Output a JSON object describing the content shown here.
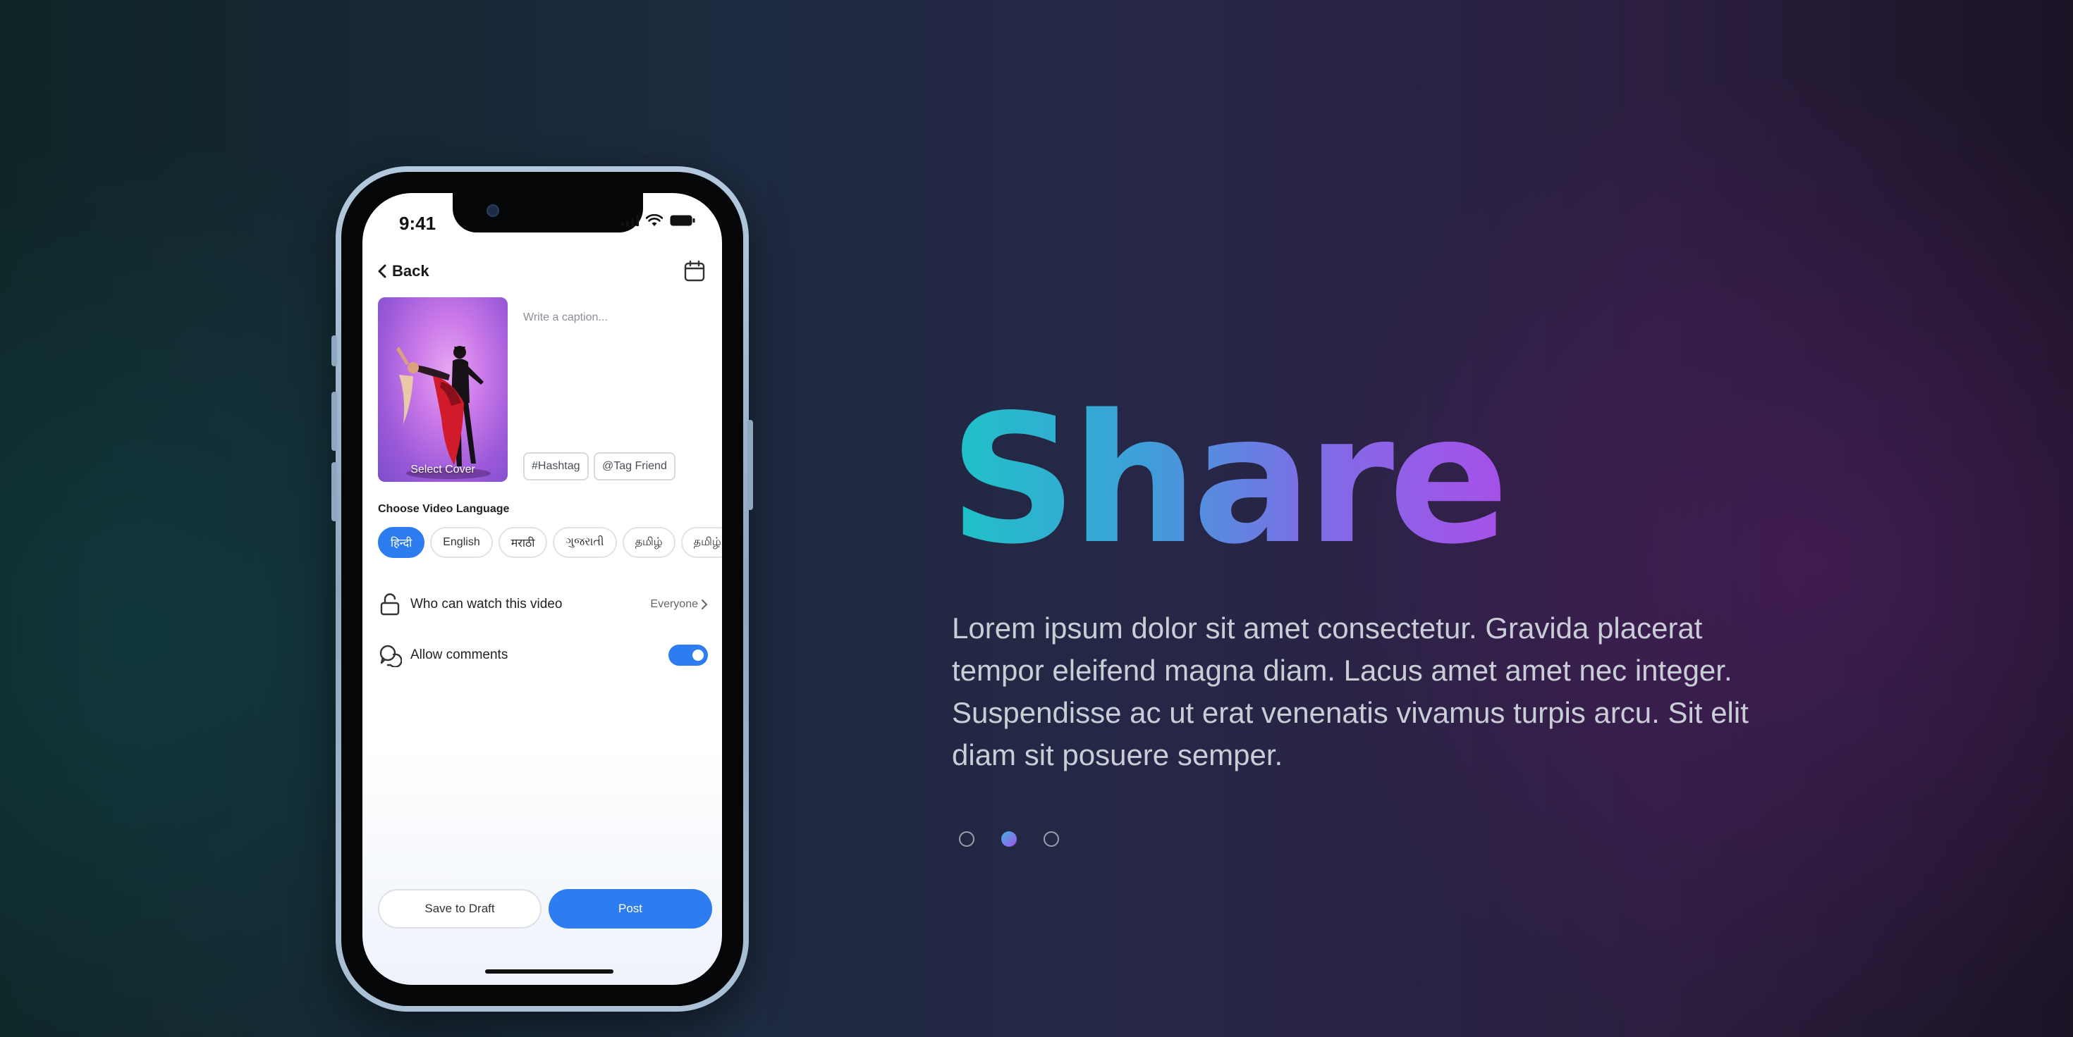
{
  "phone": {
    "status_time": "9:41",
    "back_label": "Back",
    "cover_label": "Select Cover",
    "caption_placeholder": "Write a caption...",
    "hashtag_label": "#Hashtag",
    "tag_friend_label": "@Tag Friend",
    "language_title": "Choose Video Language",
    "languages": [
      {
        "label": "हिन्दी",
        "active": true
      },
      {
        "label": "English",
        "active": false
      },
      {
        "label": "मराठी",
        "active": false
      },
      {
        "label": "ગુજરાતી",
        "active": false
      },
      {
        "label": "தமிழ்",
        "active": false
      },
      {
        "label": "தமிழ்",
        "active": false
      }
    ],
    "privacy_label": "Who can watch this video",
    "privacy_value": "Everyone",
    "comments_label": "Allow comments",
    "comments_enabled": true,
    "save_draft_label": "Save to Draft",
    "post_label": "Post"
  },
  "hero": {
    "title": "Share",
    "body": "Lorem ipsum dolor sit amet consectetur. Gravida placerat tempor eleifend magna diam. Lacus amet amet nec integer. Suspendisse ac ut erat venenatis vivamus turpis arcu. Sit elit diam sit posuere semper."
  },
  "pagination": {
    "total": 3,
    "active_index": 1
  },
  "colors": {
    "accent": "#2d7cf0",
    "title_gradient_start": "#1ec3c7",
    "title_gradient_end": "#a650e8",
    "body_text": "#c9ced6"
  }
}
